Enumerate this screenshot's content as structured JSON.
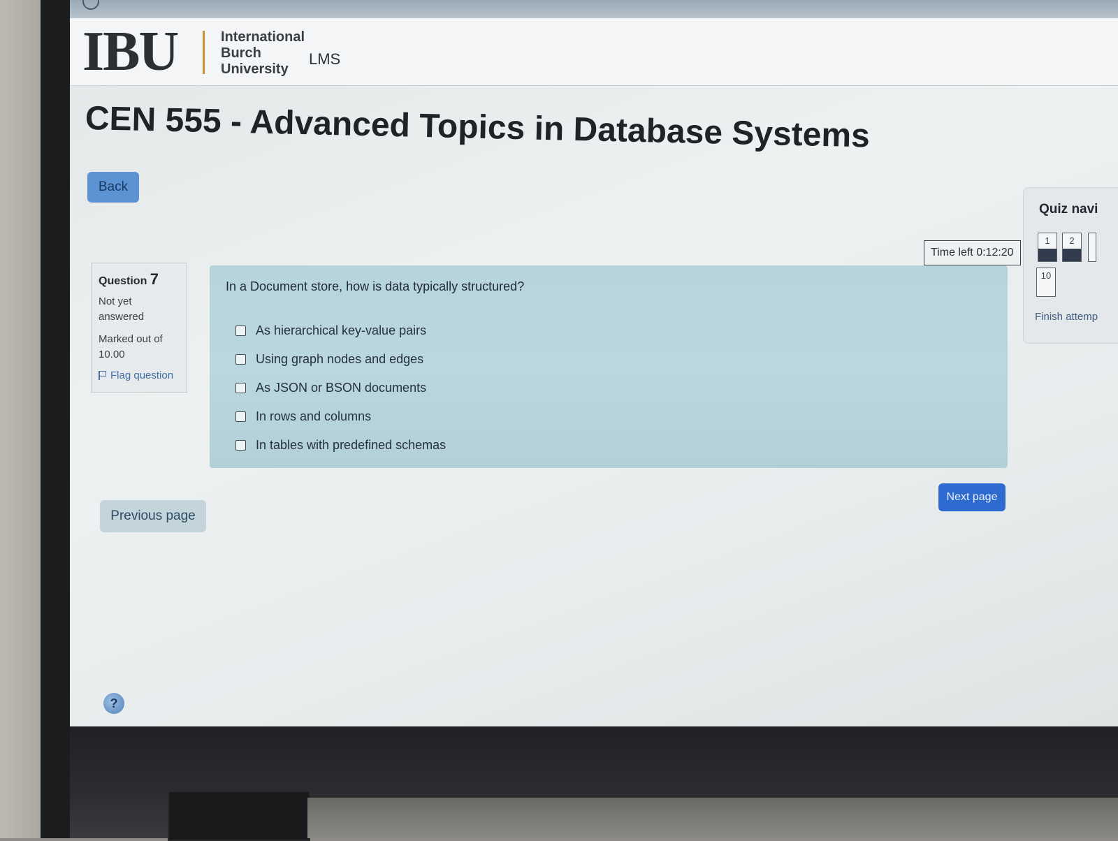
{
  "header": {
    "logo_mark": "IBU",
    "logo_lines": [
      "International",
      "Burch",
      "University"
    ],
    "lms_label": "LMS"
  },
  "course": {
    "title": "CEN 555 - Advanced Topics in Database Systems"
  },
  "nav": {
    "back_label": "Back",
    "previous_label": "Previous page",
    "next_label": "Next page"
  },
  "timer": {
    "text": "Time left 0:12:20"
  },
  "question_info": {
    "label": "Question",
    "number": "7",
    "state": "Not yet answered",
    "marks": "Marked out of 10.00",
    "flag_label": "Flag question"
  },
  "question": {
    "text": "In a Document store, how is data typically structured?",
    "options": [
      "As hierarchical key-value pairs",
      "Using graph nodes and edges",
      "As JSON or BSON documents",
      "In rows and columns",
      "In tables with predefined schemas"
    ]
  },
  "quiz_nav": {
    "title": "Quiz navi",
    "buttons": [
      "1",
      "2",
      "10"
    ],
    "finish_label": "Finish attemp"
  },
  "colors": {
    "primary_button": "#2d6bd0",
    "question_panel": "#b7d4dc",
    "logo_accent": "#c9932e"
  }
}
